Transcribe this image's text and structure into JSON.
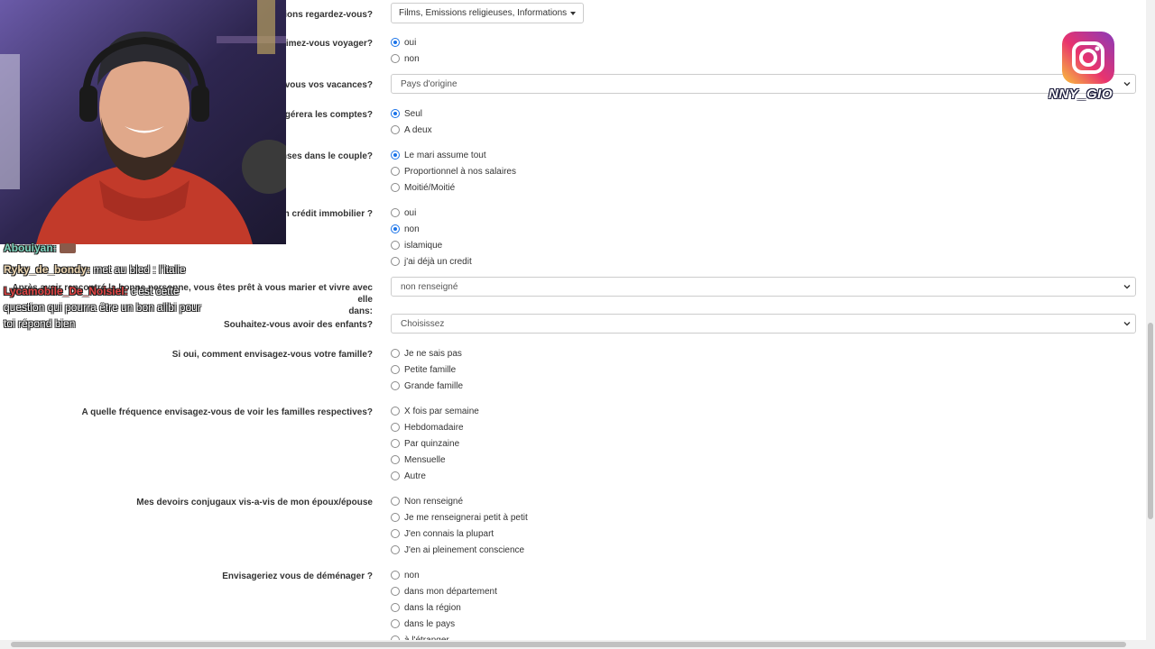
{
  "form": {
    "q_tv": "sions regardez-vous?",
    "tv_value": "Films, Emissions religieuses, Informations",
    "q_travel": "Aimez-vous voyager?",
    "travel_options": [
      "oui",
      "non"
    ],
    "q_vacances": "z-vous vos vacances?",
    "vacances_value": "Pays d'origine",
    "q_comptes": "i gérera les comptes?",
    "comptes_options": [
      "Seul",
      "A deux"
    ],
    "q_depenses": "enses dans le couple?",
    "depenses_options": [
      "Le mari assume tout",
      "Proportionnel à nos salaires",
      "Moitié/Moitié"
    ],
    "q_credit": "un crédit immobilier ?",
    "credit_options": [
      "oui",
      "non",
      "islamique",
      "j'ai déjà un credit"
    ],
    "q_apres_line1": "Après avoir rencontré la bonne personne, vous êtes prêt à vous marier et vivre avec elle",
    "q_apres_line2": "dans:",
    "apres_value": "non renseigné",
    "q_enfants": "Souhaitez-vous avoir des enfants?",
    "enfants_value": "Choisissez",
    "q_famille": "Si oui, comment envisagez-vous votre famille?",
    "famille_options": [
      "Je ne sais pas",
      "Petite famille",
      "Grande famille"
    ],
    "q_frequence": "A quelle fréquence envisagez-vous de voir les familles respectives?",
    "frequence_options": [
      "X fois par semaine",
      "Hebdomadaire",
      "Par quinzaine",
      "Mensuelle",
      "Autre"
    ],
    "q_devoirs": "Mes devoirs conjugaux vis-a-vis de mon époux/épouse",
    "devoirs_options": [
      "Non renseigné",
      "Je me renseignerai petit à petit",
      "J'en connais la plupart",
      "J'en ai pleinement conscience"
    ],
    "q_demenager": "Envisageriez vous de déménager ?",
    "demenager_options": [
      "non",
      "dans mon département",
      "dans la région",
      "dans le pays",
      "à l'étranger"
    ]
  },
  "chat": [
    {
      "user": "Abouiyan:",
      "msg": ""
    },
    {
      "user": "Ryky_de_bondy:",
      "msg": "met au bled : l'italie"
    },
    {
      "user": "Lycamobile_De_Noisiel:",
      "msg": "c'est cette"
    },
    {
      "user": "",
      "msg": "question qui pourra être un bon alibi pour"
    },
    {
      "user": "",
      "msg": "toi répond bien"
    }
  ],
  "overlay": {
    "instagram_handle": "NNY_GIO"
  },
  "colors": {
    "radio_checked": "#1a73e8",
    "text": "#333333"
  }
}
